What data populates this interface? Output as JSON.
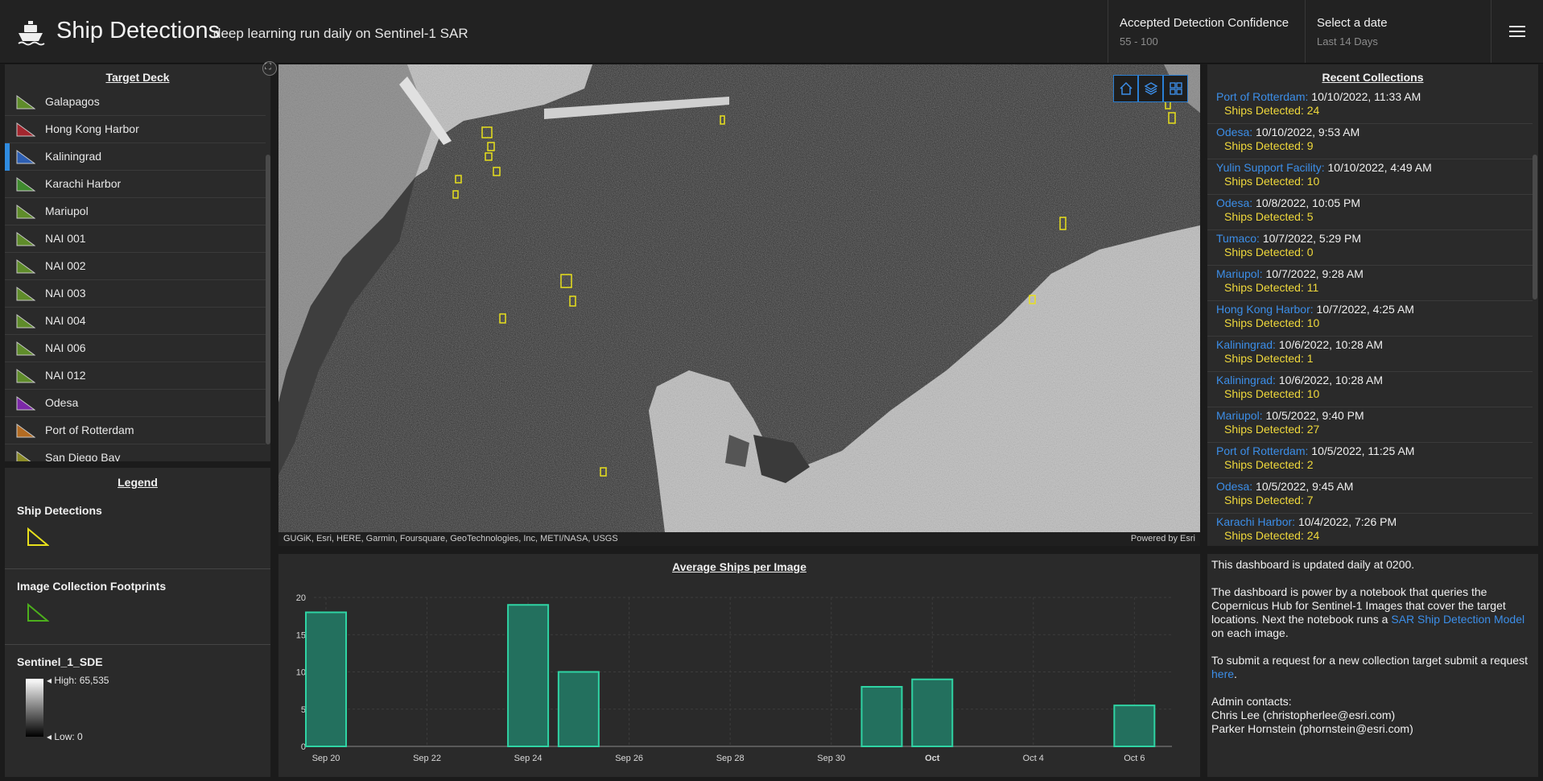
{
  "header": {
    "title": "Ship Detections",
    "subtitle": "deep learning run daily on Sentinel-1 SAR",
    "confidence_label": "Accepted Detection Confidence",
    "confidence_value": "55 - 100",
    "date_label": "Select a date",
    "date_value": "Last 14 Days"
  },
  "target_deck": {
    "title": "Target Deck",
    "items": [
      {
        "name": "Galapagos",
        "color": "#5f8c2a"
      },
      {
        "name": "Hong Kong Harbor",
        "color": "#a3262e"
      },
      {
        "name": "Kaliningrad",
        "color": "#2d5fb3"
      },
      {
        "name": "Karachi Harbor",
        "color": "#3f8a2e"
      },
      {
        "name": "Mariupol",
        "color": "#5f8c2a"
      },
      {
        "name": "NAI 001",
        "color": "#5f8c2a"
      },
      {
        "name": "NAI 002",
        "color": "#5f8c2a"
      },
      {
        "name": "NAI 003",
        "color": "#5f8c2a"
      },
      {
        "name": "NAI 004",
        "color": "#5f8c2a"
      },
      {
        "name": "NAI 006",
        "color": "#5f8c2a"
      },
      {
        "name": "NAI 012",
        "color": "#5f8c2a"
      },
      {
        "name": "Odesa",
        "color": "#7c28a8"
      },
      {
        "name": "Port of Rotterdam",
        "color": "#b36b22"
      },
      {
        "name": "San Diego Bay",
        "color": "#8a8a26"
      }
    ],
    "selected": "Kaliningrad"
  },
  "legend": {
    "title": "Legend",
    "ship_detections": "Ship Detections",
    "footprints": "Image Collection Footprints",
    "layer_name": "Sentinel_1_SDE",
    "high": "High: 65,535",
    "low": "Low: 0",
    "ship_color": "#e8e01c",
    "footprint_color": "#4caf1c"
  },
  "map": {
    "attribution": "GUGiK, Esri, HERE, Garmin, Foursquare, GeoTechnologies, Inc, METI/NASA, USGS",
    "powered_by": "Powered by Esri",
    "tools": [
      "home-icon",
      "layers-icon",
      "basemap-gallery-icon"
    ]
  },
  "recent_collections": {
    "title": "Recent Collections",
    "items": [
      {
        "location": "Port of Rotterdam:",
        "date": "10/10/2022, 11:33 AM",
        "ships": "Ships Detected: 24"
      },
      {
        "location": "Odesa:",
        "date": "10/10/2022, 9:53 AM",
        "ships": "Ships Detected: 9"
      },
      {
        "location": "Yulin Support Facility:",
        "date": "10/10/2022, 4:49 AM",
        "ships": "Ships Detected: 10"
      },
      {
        "location": "Odesa:",
        "date": "10/8/2022, 10:05 PM",
        "ships": "Ships Detected: 5"
      },
      {
        "location": "Tumaco:",
        "date": "10/7/2022, 5:29 PM",
        "ships": "Ships Detected: 0"
      },
      {
        "location": "Mariupol:",
        "date": "10/7/2022, 9:28 AM",
        "ships": "Ships Detected: 11"
      },
      {
        "location": "Hong Kong Harbor:",
        "date": "10/7/2022, 4:25 AM",
        "ships": "Ships Detected: 10"
      },
      {
        "location": "Kaliningrad:",
        "date": "10/6/2022, 10:28 AM",
        "ships": "Ships Detected: 1"
      },
      {
        "location": "Kaliningrad:",
        "date": "10/6/2022, 10:28 AM",
        "ships": "Ships Detected: 10"
      },
      {
        "location": "Mariupol:",
        "date": "10/5/2022, 9:40 PM",
        "ships": "Ships Detected: 27"
      },
      {
        "location": "Port of Rotterdam:",
        "date": "10/5/2022, 11:25 AM",
        "ships": "Ships Detected: 2"
      },
      {
        "location": "Odesa:",
        "date": "10/5/2022, 9:45 AM",
        "ships": "Ships Detected: 7"
      },
      {
        "location": "Karachi Harbor:",
        "date": "10/4/2022, 7:26 PM",
        "ships": "Ships Detected: 24"
      }
    ]
  },
  "chart_data": {
    "type": "bar",
    "title": "Average Ships per Image",
    "xlabel": "",
    "ylabel": "",
    "x": [
      "Sep 20",
      "Sep 24",
      "Sep 25",
      "Oct 1",
      "Oct 2",
      "Oct 6"
    ],
    "values": [
      18,
      19,
      10,
      8,
      9,
      5.5
    ],
    "x_ticks": [
      "Sep 20",
      "Sep 22",
      "Sep 24",
      "Sep 26",
      "Sep 28",
      "Sep 30",
      "Oct",
      "Oct 4",
      "Oct 6"
    ],
    "y_ticks": [
      0,
      5,
      10,
      15,
      20
    ],
    "ylim": [
      0,
      20
    ],
    "grid": true,
    "bar_color": "#23705e",
    "bar_edge_color": "#2fd4a4"
  },
  "info": {
    "line1": "This dashboard is updated daily at 0200.",
    "para2_a": "The dashboard is power by a notebook that  queries the Copernicus Hub for Sentinel-1 Images that cover the target locations. Next the notebook runs a ",
    "para2_link": "SAR Ship Detection Model",
    "para2_b": " on each image.",
    "para3_a": "To submit a request for a new collection target submit a request ",
    "para3_link": "here",
    "para3_b": ".",
    "contacts_label": "Admin contacts:",
    "contact1": "Chris Lee (christopherlee@esri.com)",
    "contact2": "Parker Hornstein (phornstein@esri.com)"
  }
}
